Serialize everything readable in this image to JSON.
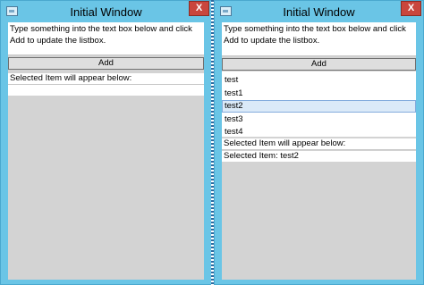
{
  "left_window": {
    "title": "Initial Window",
    "close_label": "X",
    "instruction": "Type something into the text box below and click Add to update the listbox.",
    "textbox_value": "",
    "add_label": "Add",
    "selected_caption": "Selected Item will appear below:",
    "selected_value": ""
  },
  "right_window": {
    "title": "Initial Window",
    "close_label": "X",
    "instruction": "Type something into the text box below and click Add to update the listbox.",
    "textbox_value": "",
    "add_label": "Add",
    "list_items": [
      "test",
      "test1",
      "test2",
      "test3",
      "test4"
    ],
    "selected_index": 2,
    "selected_caption": "Selected Item will appear below:",
    "selected_value": "Selected Item: test2"
  },
  "colors": {
    "window_frame": "#6ac5e6",
    "close_button": "#c9463d",
    "client_area": "#d3d3d3",
    "selection": "#dbeaf8"
  }
}
